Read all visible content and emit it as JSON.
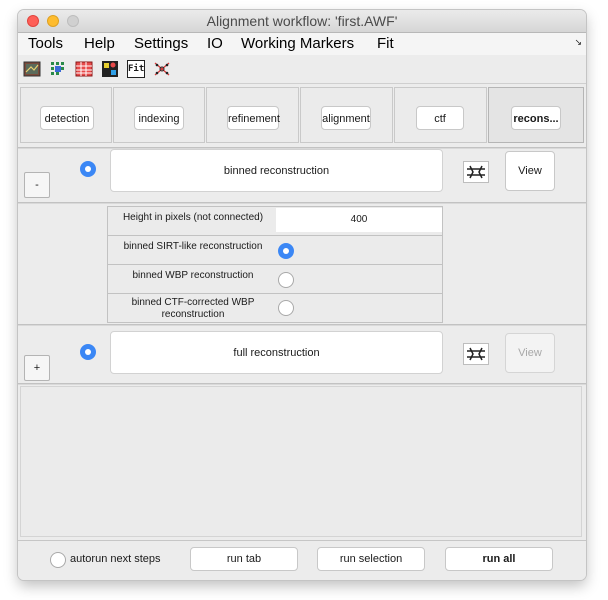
{
  "window": {
    "title": "Alignment workflow: 'first.AWF'"
  },
  "menu": {
    "items": [
      "Tools",
      "Help",
      "Settings",
      "IO",
      "Working Markers",
      "Fit"
    ]
  },
  "toolbar": {
    "fit_label": "Fit"
  },
  "tabs": [
    {
      "label": "detection"
    },
    {
      "label": "indexing"
    },
    {
      "label": "refinement"
    },
    {
      "label": "alignment"
    },
    {
      "label": "ctf"
    },
    {
      "label": "recons..."
    }
  ],
  "binned": {
    "toggle_label": "-",
    "title": "binned reconstruction",
    "view_label": "View",
    "settings": {
      "height_label": "Height in pixels (not connected)",
      "height_value": "400",
      "sirt_label": "binned SIRT-like reconstruction",
      "wbp_label": "binned WBP reconstruction",
      "ctf_wbp_label": "binned CTF-corrected WBP reconstruction"
    }
  },
  "full": {
    "toggle_label": "+",
    "title": "full reconstruction",
    "view_label": "View"
  },
  "bottom": {
    "autorun_label": "autorun next steps",
    "run_tab_label": "run tab",
    "run_selection_label": "run selection",
    "run_all_label": "run all"
  },
  "colors": {
    "radio_selected": "#3b87f5",
    "close": "#fe5f57",
    "minimize": "#febc2e"
  }
}
